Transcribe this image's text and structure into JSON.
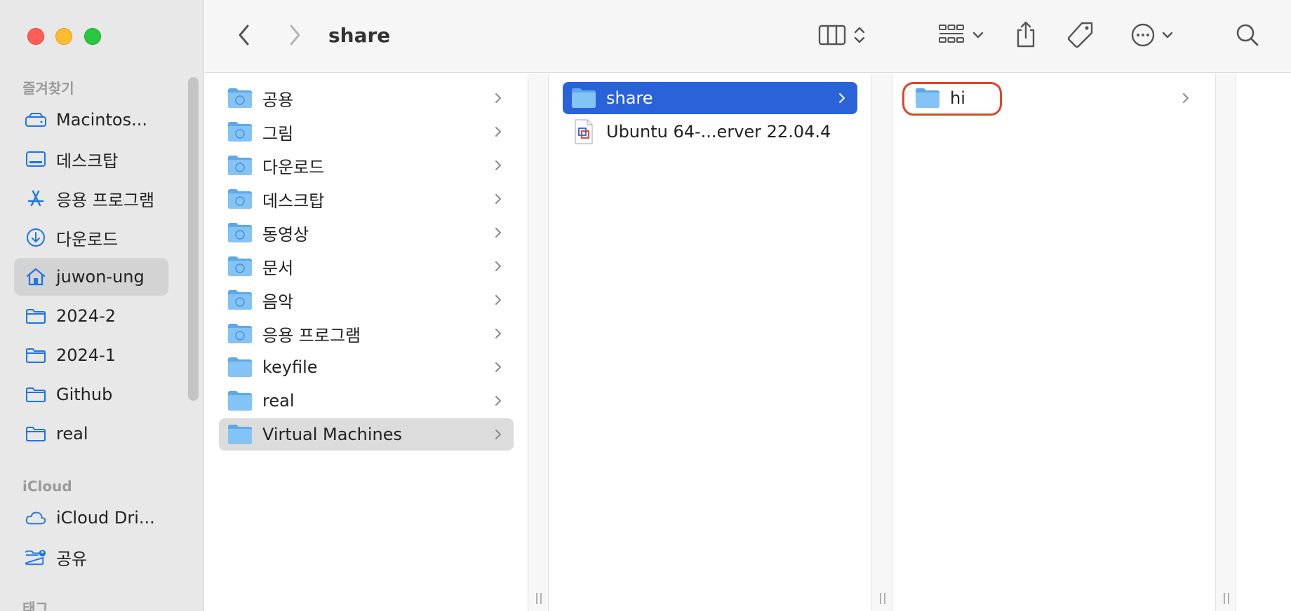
{
  "window": {
    "title": "share"
  },
  "sidebar": {
    "favorites_header": "즐겨찾기",
    "icloud_header": "iCloud",
    "tags_header": "태그",
    "favorites": [
      {
        "label": "Macintos...",
        "icon": "hard-drive-icon"
      },
      {
        "label": "데스크탑",
        "icon": "desktop-icon"
      },
      {
        "label": "응용 프로그램",
        "icon": "applications-icon"
      },
      {
        "label": "다운로드",
        "icon": "downloads-icon"
      },
      {
        "label": "juwon-ung",
        "icon": "home-icon",
        "selected": true
      },
      {
        "label": "2024-2",
        "icon": "folder-icon"
      },
      {
        "label": "2024-1",
        "icon": "folder-icon"
      },
      {
        "label": "Github",
        "icon": "folder-icon"
      },
      {
        "label": "real",
        "icon": "folder-icon"
      }
    ],
    "icloud": [
      {
        "label": "iCloud Dri...",
        "icon": "cloud-icon"
      },
      {
        "label": "공유",
        "icon": "shared-folder-icon"
      }
    ]
  },
  "toolbar": {
    "back": "back-chevron-icon",
    "forward": "forward-chevron-icon",
    "view_mode": "column-view-icon",
    "group": "group-grid-icon",
    "share": "share-icon",
    "tag": "tag-icon",
    "more": "more-icon",
    "search": "search-icon"
  },
  "columns": {
    "col1": [
      {
        "label": "공용",
        "badge": "public"
      },
      {
        "label": "그림",
        "badge": "pictures"
      },
      {
        "label": "다운로드",
        "badge": "downloads"
      },
      {
        "label": "데스크탑",
        "badge": "desktop"
      },
      {
        "label": "동영상",
        "badge": "movies"
      },
      {
        "label": "문서",
        "badge": "documents"
      },
      {
        "label": "음악",
        "badge": "music"
      },
      {
        "label": "응용 프로그램",
        "badge": "apps"
      },
      {
        "label": "keyfile",
        "badge": ""
      },
      {
        "label": "real",
        "badge": ""
      },
      {
        "label": "Virtual Machines",
        "badge": "",
        "selected": true
      }
    ],
    "col2": [
      {
        "label": "share",
        "type": "folder",
        "selected": true
      },
      {
        "label": "Ubuntu 64-...erver 22.04.4",
        "type": "vm-file"
      }
    ],
    "col3": [
      {
        "label": "hi",
        "type": "folder"
      }
    ]
  },
  "colors": {
    "selection_blue": "#2a63d9",
    "highlight_red": "#e0442e",
    "folder_blue": "#74b9f0",
    "sidebar_accent": "#1f74e6"
  }
}
